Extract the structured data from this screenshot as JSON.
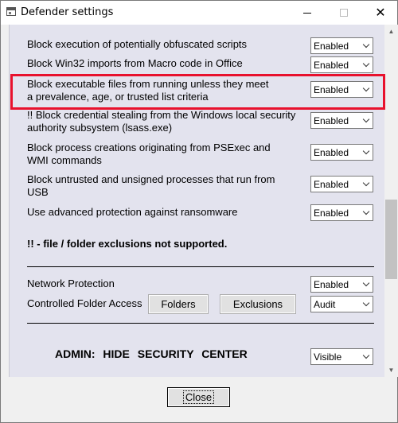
{
  "window": {
    "title": "Defender settings",
    "close_glyph": "✕"
  },
  "asr_rules": [
    {
      "label_line1": "Block execution of potentially obfuscated scripts",
      "label_line2": "",
      "value": "Enabled"
    },
    {
      "label_line1": "Block Win32 imports from Macro code in Office",
      "label_line2": "",
      "value": "Enabled"
    },
    {
      "label_line1": "Block executable files from running unless they meet",
      "label_line2": "a prevalence, age, or trusted list criteria",
      "value": "Enabled",
      "highlighted": true
    },
    {
      "label_line1": "!! Block credential stealing from the Windows local security",
      "label_line2": "authority subsystem (lsass.exe)",
      "value": "Enabled"
    },
    {
      "label_line1": "Block process creations originating from PSExec and",
      "label_line2": "WMI commands",
      "value": "Enabled"
    },
    {
      "label_line1": "Block untrusted and unsigned processes that run from",
      "label_line2": "USB",
      "value": "Enabled"
    },
    {
      "label_line1": "Use advanced protection against ransomware",
      "label_line2": "",
      "value": "Enabled"
    }
  ],
  "note": "!! - file / folder exclusions not supported.",
  "network_protection": {
    "label": "Network Protection",
    "value": "Enabled"
  },
  "controlled_folder_access": {
    "label": "Controlled Folder Access",
    "folders_label": "Folders",
    "exclusions_label": "Exclusions",
    "value": "Audit"
  },
  "admin": {
    "label": "ADMIN:  HIDE  SECURITY  CENTER",
    "value": "Visible"
  },
  "footer": {
    "close_label": "Close"
  },
  "colors": {
    "highlight": "#e8112d",
    "panel": "#e3e3ee"
  },
  "icons": {
    "app": "window-icon",
    "combo_arrow": "chevron-down-icon"
  }
}
